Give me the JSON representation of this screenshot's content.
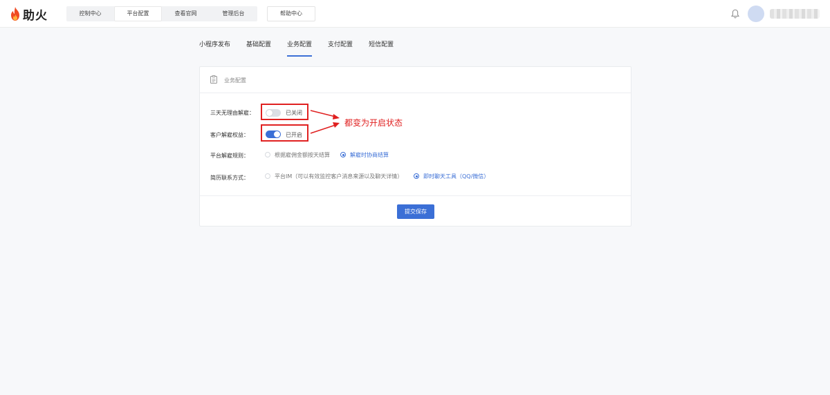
{
  "brand": {
    "name": "助火",
    "accent": "#3b6fd6",
    "flame_color": "#f04b23"
  },
  "top_nav": {
    "items": [
      {
        "label": "控制中心",
        "active": false
      },
      {
        "label": "平台配置",
        "active": true
      },
      {
        "label": "查看官网",
        "active": false
      },
      {
        "label": "管理后台",
        "active": false
      }
    ],
    "help": "帮助中心",
    "icons": [
      "bell-icon"
    ]
  },
  "tabs": [
    {
      "label": "小程序发布",
      "active": false
    },
    {
      "label": "基础配置",
      "active": false
    },
    {
      "label": "业务配置",
      "active": true
    },
    {
      "label": "支付配置",
      "active": false
    },
    {
      "label": "短信配置",
      "active": false
    }
  ],
  "card": {
    "title": "业务配置",
    "icon": "clipboard-icon",
    "settings": {
      "refund_label": "三天无理由解雇：",
      "refund_switch": {
        "on": false,
        "text": "已关闭"
      },
      "rights_label": "客户解雇权益：",
      "rights_switch": {
        "on": true,
        "text": "已开启"
      },
      "rule_label": "平台解雇规则：",
      "rule_options": [
        {
          "label": "根据雇佣金额按天结算",
          "checked": false
        },
        {
          "label": "解雇时协商结算",
          "checked": true
        }
      ],
      "contact_label": "简历联系方式：",
      "contact_options": [
        {
          "label": "平台IM（可以有效监控客户消息来源以及聊天详情）",
          "checked": false
        },
        {
          "label": "即时聊天工具（QQ/微信）",
          "checked": true
        }
      ]
    },
    "submit_label": "提交保存"
  },
  "annotation": {
    "text": "都变为开启状态",
    "color": "#e02020"
  }
}
